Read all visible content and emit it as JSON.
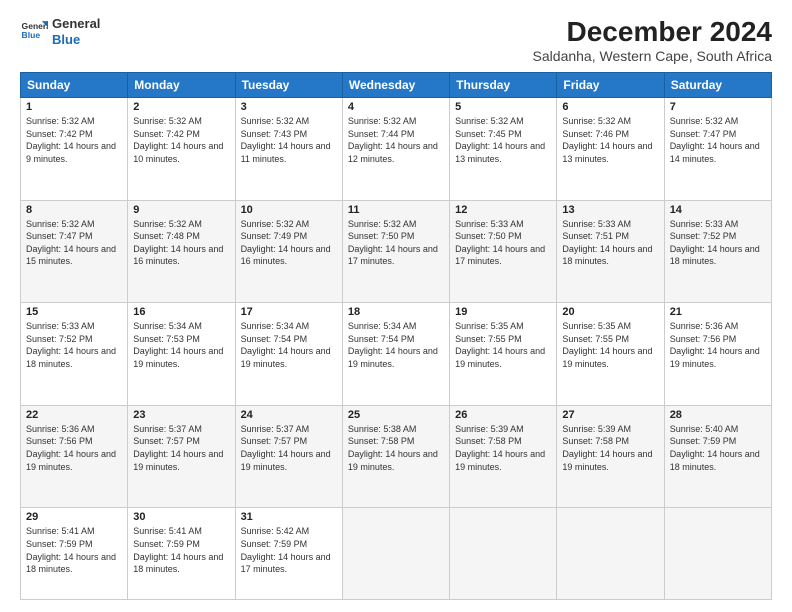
{
  "logo": {
    "line1": "General",
    "line2": "Blue"
  },
  "title": "December 2024",
  "subtitle": "Saldanha, Western Cape, South Africa",
  "headers": [
    "Sunday",
    "Monday",
    "Tuesday",
    "Wednesday",
    "Thursday",
    "Friday",
    "Saturday"
  ],
  "weeks": [
    [
      {
        "day": "1",
        "sunrise": "5:32 AM",
        "sunset": "7:42 PM",
        "daylight": "14 hours and 9 minutes."
      },
      {
        "day": "2",
        "sunrise": "5:32 AM",
        "sunset": "7:42 PM",
        "daylight": "14 hours and 10 minutes."
      },
      {
        "day": "3",
        "sunrise": "5:32 AM",
        "sunset": "7:43 PM",
        "daylight": "14 hours and 11 minutes."
      },
      {
        "day": "4",
        "sunrise": "5:32 AM",
        "sunset": "7:44 PM",
        "daylight": "14 hours and 12 minutes."
      },
      {
        "day": "5",
        "sunrise": "5:32 AM",
        "sunset": "7:45 PM",
        "daylight": "14 hours and 13 minutes."
      },
      {
        "day": "6",
        "sunrise": "5:32 AM",
        "sunset": "7:46 PM",
        "daylight": "14 hours and 13 minutes."
      },
      {
        "day": "7",
        "sunrise": "5:32 AM",
        "sunset": "7:47 PM",
        "daylight": "14 hours and 14 minutes."
      }
    ],
    [
      {
        "day": "8",
        "sunrise": "5:32 AM",
        "sunset": "7:47 PM",
        "daylight": "14 hours and 15 minutes."
      },
      {
        "day": "9",
        "sunrise": "5:32 AM",
        "sunset": "7:48 PM",
        "daylight": "14 hours and 16 minutes."
      },
      {
        "day": "10",
        "sunrise": "5:32 AM",
        "sunset": "7:49 PM",
        "daylight": "14 hours and 16 minutes."
      },
      {
        "day": "11",
        "sunrise": "5:32 AM",
        "sunset": "7:50 PM",
        "daylight": "14 hours and 17 minutes."
      },
      {
        "day": "12",
        "sunrise": "5:33 AM",
        "sunset": "7:50 PM",
        "daylight": "14 hours and 17 minutes."
      },
      {
        "day": "13",
        "sunrise": "5:33 AM",
        "sunset": "7:51 PM",
        "daylight": "14 hours and 18 minutes."
      },
      {
        "day": "14",
        "sunrise": "5:33 AM",
        "sunset": "7:52 PM",
        "daylight": "14 hours and 18 minutes."
      }
    ],
    [
      {
        "day": "15",
        "sunrise": "5:33 AM",
        "sunset": "7:52 PM",
        "daylight": "14 hours and 18 minutes."
      },
      {
        "day": "16",
        "sunrise": "5:34 AM",
        "sunset": "7:53 PM",
        "daylight": "14 hours and 19 minutes."
      },
      {
        "day": "17",
        "sunrise": "5:34 AM",
        "sunset": "7:54 PM",
        "daylight": "14 hours and 19 minutes."
      },
      {
        "day": "18",
        "sunrise": "5:34 AM",
        "sunset": "7:54 PM",
        "daylight": "14 hours and 19 minutes."
      },
      {
        "day": "19",
        "sunrise": "5:35 AM",
        "sunset": "7:55 PM",
        "daylight": "14 hours and 19 minutes."
      },
      {
        "day": "20",
        "sunrise": "5:35 AM",
        "sunset": "7:55 PM",
        "daylight": "14 hours and 19 minutes."
      },
      {
        "day": "21",
        "sunrise": "5:36 AM",
        "sunset": "7:56 PM",
        "daylight": "14 hours and 19 minutes."
      }
    ],
    [
      {
        "day": "22",
        "sunrise": "5:36 AM",
        "sunset": "7:56 PM",
        "daylight": "14 hours and 19 minutes."
      },
      {
        "day": "23",
        "sunrise": "5:37 AM",
        "sunset": "7:57 PM",
        "daylight": "14 hours and 19 minutes."
      },
      {
        "day": "24",
        "sunrise": "5:37 AM",
        "sunset": "7:57 PM",
        "daylight": "14 hours and 19 minutes."
      },
      {
        "day": "25",
        "sunrise": "5:38 AM",
        "sunset": "7:58 PM",
        "daylight": "14 hours and 19 minutes."
      },
      {
        "day": "26",
        "sunrise": "5:39 AM",
        "sunset": "7:58 PM",
        "daylight": "14 hours and 19 minutes."
      },
      {
        "day": "27",
        "sunrise": "5:39 AM",
        "sunset": "7:58 PM",
        "daylight": "14 hours and 19 minutes."
      },
      {
        "day": "28",
        "sunrise": "5:40 AM",
        "sunset": "7:59 PM",
        "daylight": "14 hours and 18 minutes."
      }
    ],
    [
      {
        "day": "29",
        "sunrise": "5:41 AM",
        "sunset": "7:59 PM",
        "daylight": "14 hours and 18 minutes."
      },
      {
        "day": "30",
        "sunrise": "5:41 AM",
        "sunset": "7:59 PM",
        "daylight": "14 hours and 18 minutes."
      },
      {
        "day": "31",
        "sunrise": "5:42 AM",
        "sunset": "7:59 PM",
        "daylight": "14 hours and 17 minutes."
      },
      null,
      null,
      null,
      null
    ]
  ]
}
